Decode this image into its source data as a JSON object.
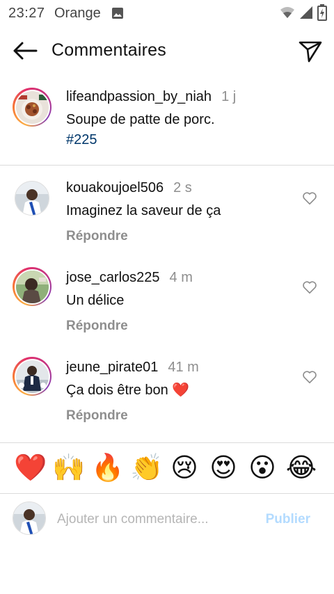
{
  "status_bar": {
    "time": "23:27",
    "carrier": "Orange",
    "icons": [
      "gallery-icon",
      "wifi-icon",
      "signal-icon",
      "battery-charging-icon"
    ]
  },
  "header": {
    "title": "Commentaires",
    "back_icon": "arrow-left-icon",
    "send_icon": "paper-plane-icon"
  },
  "caption": {
    "username": "lifeandpassion_by_niah",
    "time": "1 j",
    "text": "Soupe de patte de porc.",
    "hashtag": "#225"
  },
  "comments": [
    {
      "username": "kouakoujoel506",
      "time": "2 s",
      "text": "Imaginez la saveur de ça",
      "reply_label": "Répondre",
      "story_ring": false
    },
    {
      "username": "jose_carlos225",
      "time": "4 m",
      "text": "Un délice",
      "reply_label": "Répondre",
      "story_ring": true
    },
    {
      "username": "jeune_pirate01",
      "time": "41 m",
      "text": "Ça dois être bon ❤️",
      "reply_label": "Répondre",
      "story_ring": true
    }
  ],
  "quick_reactions": [
    "❤️",
    "🙌",
    "🔥",
    "👏",
    "😢",
    "😍",
    "😮",
    "😂"
  ],
  "composer": {
    "placeholder": "Ajouter un commentaire...",
    "publish_label": "Publier"
  },
  "colors": {
    "hashtag": "#00376b",
    "secondary_text": "#8e8e8e",
    "publish_disabled": "#b3dbff",
    "divider": "#dbdbdb"
  }
}
